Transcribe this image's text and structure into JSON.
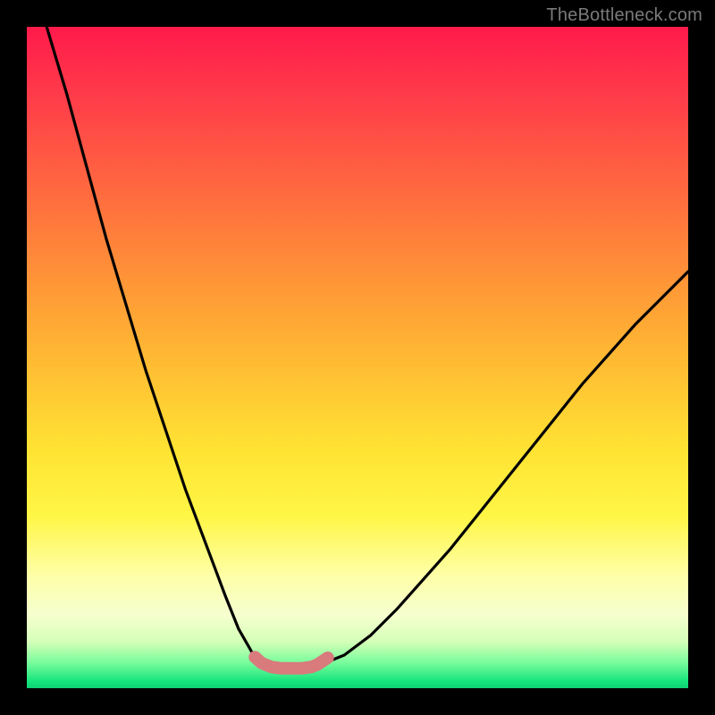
{
  "watermark": "TheBottleneck.com",
  "chart_data": {
    "type": "line",
    "title": "",
    "xlabel": "",
    "ylabel": "",
    "xlim": [
      0,
      100
    ],
    "ylim": [
      0,
      100
    ],
    "grid": false,
    "legend": false,
    "annotations": [],
    "series": [
      {
        "name": "left-curve",
        "color": "#000000",
        "x": [
          3,
          6,
          9,
          12,
          15,
          18,
          21,
          24,
          27,
          30,
          32,
          34,
          35.5
        ],
        "values": [
          100,
          90,
          79,
          68,
          58,
          48,
          39,
          30,
          22,
          14,
          9,
          5.5,
          3.8
        ]
      },
      {
        "name": "right-curve",
        "color": "#000000",
        "x": [
          45,
          48,
          52,
          56,
          60,
          64,
          68,
          72,
          76,
          80,
          84,
          88,
          92,
          96,
          100
        ],
        "values": [
          3.8,
          5.0,
          8.0,
          12,
          16.5,
          21,
          26,
          31,
          36,
          41,
          46,
          50.5,
          55,
          59,
          63
        ]
      },
      {
        "name": "valley-bottom",
        "color": "#d97a7d",
        "x": [
          34.5,
          35.5,
          37,
          38.5,
          40,
          41.5,
          43,
          44,
          45.5
        ],
        "values": [
          4.7,
          3.8,
          3.2,
          3.0,
          3.0,
          3.0,
          3.2,
          3.6,
          4.6
        ]
      }
    ],
    "markers": [
      {
        "x": 34.5,
        "y": 4.7,
        "color": "#d97a7d",
        "r": 6
      },
      {
        "x": 36.0,
        "y": 3.5,
        "color": "#d97a7d",
        "r": 6
      },
      {
        "x": 43.8,
        "y": 3.4,
        "color": "#d97a7d",
        "r": 6
      },
      {
        "x": 45.0,
        "y": 4.2,
        "color": "#d97a7d",
        "r": 6
      }
    ]
  }
}
